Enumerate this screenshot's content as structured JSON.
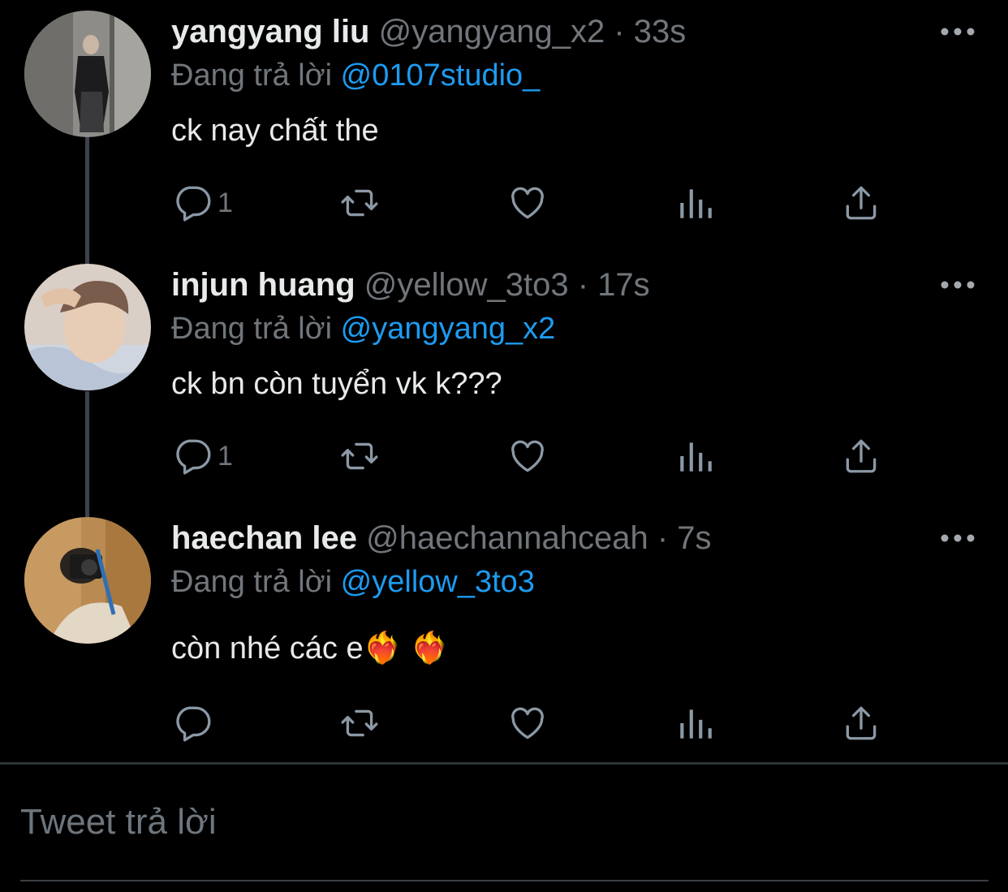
{
  "tweets": [
    {
      "name": "yangyang liu",
      "handle": "@yangyang_x2",
      "separator": "·",
      "time": "33s",
      "reply_prefix": "Đang trả lời",
      "reply_to": "@0107studio_",
      "text": "ck nay chất the",
      "reply_count": "1"
    },
    {
      "name": "injun huang",
      "handle": "@yellow_3to3",
      "separator": "·",
      "time": "17s",
      "reply_prefix": "Đang trả lời",
      "reply_to": "@yangyang_x2",
      "text": "ck bn còn tuyển vk k???",
      "reply_count": "1"
    },
    {
      "name": "haechan lee",
      "handle": "@haechannahceah",
      "separator": "·",
      "time": "7s",
      "reply_prefix": "Đang trả lời",
      "reply_to": "@yellow_3to3",
      "text": "còn nhé các e❤️‍🔥 ❤️‍🔥",
      "reply_count": ""
    }
  ],
  "compose": {
    "placeholder": "Tweet trả lời"
  },
  "colors": {
    "background": "#000000",
    "accent": "#1d9bf0",
    "muted": "#71767b",
    "text": "#e7e9ea"
  },
  "icons": [
    "reply-icon",
    "retweet-icon",
    "like-icon",
    "analytics-icon",
    "share-icon",
    "more-icon"
  ]
}
